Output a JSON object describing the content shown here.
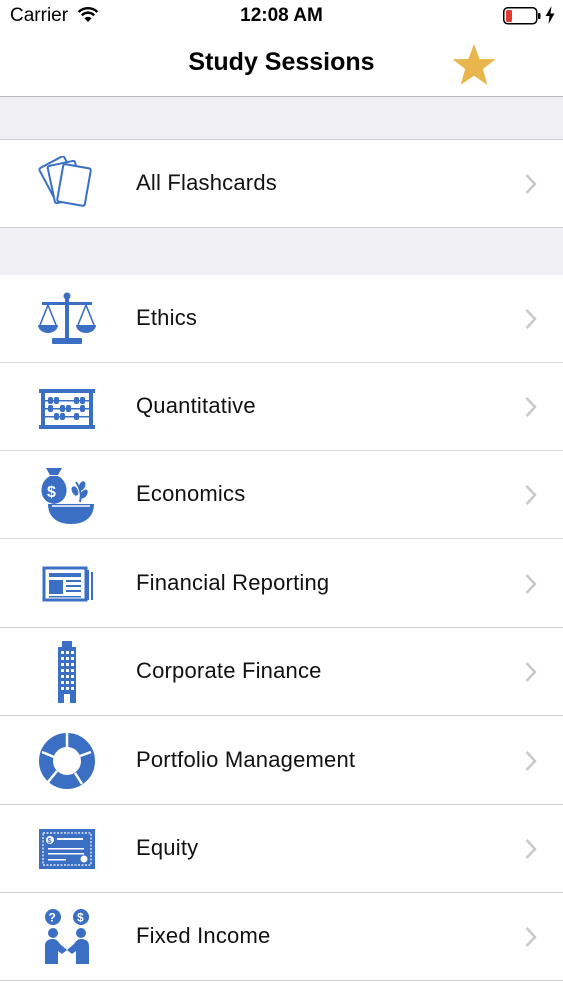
{
  "status_bar": {
    "carrier": "Carrier",
    "time": "12:08 AM"
  },
  "nav": {
    "title": "Study Sessions",
    "favorite_icon": "star-icon"
  },
  "colors": {
    "accent_blue": "#3a6fc4",
    "star_gold": "#e8b64c",
    "group_bg": "#efeff4",
    "chevron": "#c7c7cc",
    "battery_low": "#e23a30"
  },
  "all_flashcards": {
    "label": "All Flashcards",
    "icon": "flashcards-icon"
  },
  "sessions": [
    {
      "label": "Ethics",
      "icon": "scales-icon"
    },
    {
      "label": "Quantitative",
      "icon": "abacus-icon"
    },
    {
      "label": "Economics",
      "icon": "money-bag-icon"
    },
    {
      "label": "Financial Reporting",
      "icon": "newspaper-icon"
    },
    {
      "label": "Corporate Finance",
      "icon": "building-icon"
    },
    {
      "label": "Portfolio Management",
      "icon": "donut-chart-icon"
    },
    {
      "label": "Equity",
      "icon": "stock-certificate-icon"
    },
    {
      "label": "Fixed Income",
      "icon": "handshake-icon"
    }
  ]
}
